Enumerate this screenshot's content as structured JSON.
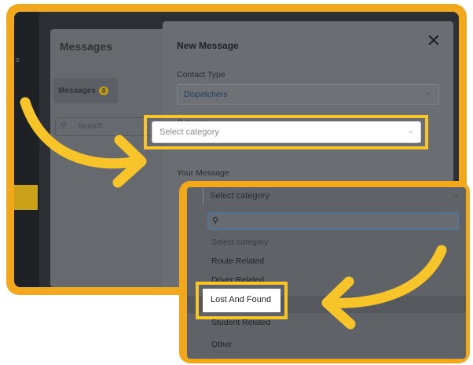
{
  "background": {
    "page": {
      "title": "Messages",
      "tab_label": "Messages",
      "tab_count": "0",
      "search_placeholder": "Search"
    }
  },
  "modal": {
    "title": "New Message",
    "close_glyph": "✕",
    "contact_type_label": "Contact Type",
    "contact_type_value": "Dispatchers",
    "category_label": "Category",
    "category_placeholder": "Select category",
    "message_label": "Your Message"
  },
  "dropdown": {
    "selected_text": "Select category",
    "options": [
      "Select category",
      "Route Related",
      "Driver Related",
      "Lost And Found",
      "Student Related",
      "Other"
    ]
  },
  "icons": {
    "close": "close-icon",
    "chevron": "chevron-down-icon",
    "search": "search-icon"
  },
  "colors": {
    "highlight": "#f7c52a",
    "frame": "#f2a81d"
  }
}
